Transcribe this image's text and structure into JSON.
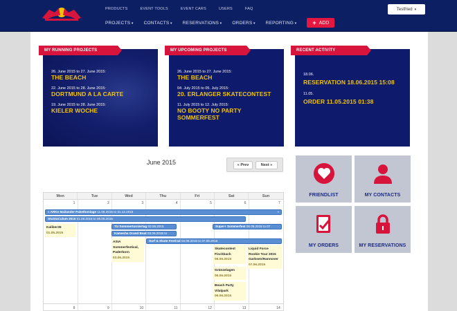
{
  "header": {
    "top_nav": [
      "PRODUCTS",
      "EVENT TOOLS",
      "EVENT CARS",
      "USERS",
      "FAQ"
    ],
    "main_nav": [
      "PROJECTS",
      "CONTACTS",
      "RESERVATIONS",
      "ORDERS",
      "REPORTING"
    ],
    "add_label": "ADD",
    "user_label": "Testfried"
  },
  "panels": {
    "running": {
      "title": "MY RUNNING PROJECTS",
      "items": [
        {
          "date": "26. June 2015 to 27. June 2015:",
          "name": "THE BEACH"
        },
        {
          "date": "22. June 2015 to 28. June 2015:",
          "name": "DORTMUND A LA CARTE"
        },
        {
          "date": "19. June 2015 to 28. June 2015:",
          "name": "KIELER WOCHE"
        }
      ]
    },
    "upcoming": {
      "title": "MY UPCOMING PROJECTS",
      "items": [
        {
          "date": "26. June 2015 to 27. June 2015:",
          "name": "THE BEACH"
        },
        {
          "date": "04. July 2015 to 05. July 2015:",
          "name": "20. ERLANGER SKATECONTEST"
        },
        {
          "date": "11. July 2015 to 12. July 2015:",
          "name": "NO BOOTY NO PARTY SOMMERFEST"
        }
      ]
    },
    "activity": {
      "title": "RECENT ACTIVITY",
      "items": [
        {
          "date": "18.06.",
          "name": "RESERVATION 18.06.2015 15:08"
        },
        {
          "date": "11.05.",
          "name": "ORDER 11.05.2015 01:38"
        }
      ]
    }
  },
  "calendar": {
    "title": "June 2015",
    "prev_label": "« Prev",
    "next_label": "Next »",
    "days": [
      "Mon",
      "Tue",
      "Wed",
      "Thu",
      "Fri",
      "Sat",
      "Sun"
    ],
    "week1": [
      "1",
      "2",
      "3",
      "4",
      "5",
      "6",
      "7"
    ],
    "week2": [
      "8",
      "9",
      "10",
      "11",
      "12",
      "13",
      "14"
    ],
    "bars": {
      "b1_name": "« ARKe Mailander Pakethonlage",
      "b1_range": "11.06.2015 to 31.12.2015",
      "b1_end": "»",
      "b2_name": "StuStaCulum 2015",
      "b2_range": "01.06.2015 to 06.06.2015",
      "b3_name": "TU Sommerturniertag",
      "b3_range": "03.06.2015",
      "b4_name": "Super+ Sommerfest",
      "b4_range": "06.06.2015 to 07",
      "b5_name": "Kamecha Grand Boat",
      "b5_range": "03.06.2015 to",
      "b6_name": "Surf & Skate Festival",
      "b6_range": "04.06.2015 to 07.06.2015"
    },
    "events": {
      "mon": {
        "name": "Kaliber35",
        "date": "01.06.2015"
      },
      "wed": {
        "l1": "ASIA",
        "l2": "Sommerfestival,",
        "l3": "Paderborn",
        "date": "03.06.2015"
      },
      "sat1": {
        "l1": "Skatecontest",
        "l2": "Fischbach",
        "date": "06.06.2015"
      },
      "sat2": {
        "l1": "Grünzelagen",
        "date": "06.06.2015"
      },
      "sat3": {
        "l1": "Beach Party",
        "l2": "Vilalpark",
        "date": "06.06.2015"
      },
      "sun": {
        "l1": "Liquid Force",
        "l2": "Rookie Tour 2015",
        "l3": "Garbsen/Hannover",
        "date": "07.06.2015"
      }
    }
  },
  "tiles": {
    "friendlist": "FRIENDLIST",
    "contacts": "MY CONTACTS",
    "orders": "MY ORDERS",
    "reservations": "MY RESERVATIONS"
  },
  "colors": {
    "header_bg": "#0c1f63",
    "accent_red": "#e3173f",
    "panel_bg": "#0e1a6b",
    "highlight_yellow": "#f4c400",
    "tile_bg": "#c2c6d2",
    "event_bar": "#5b8fd3"
  }
}
